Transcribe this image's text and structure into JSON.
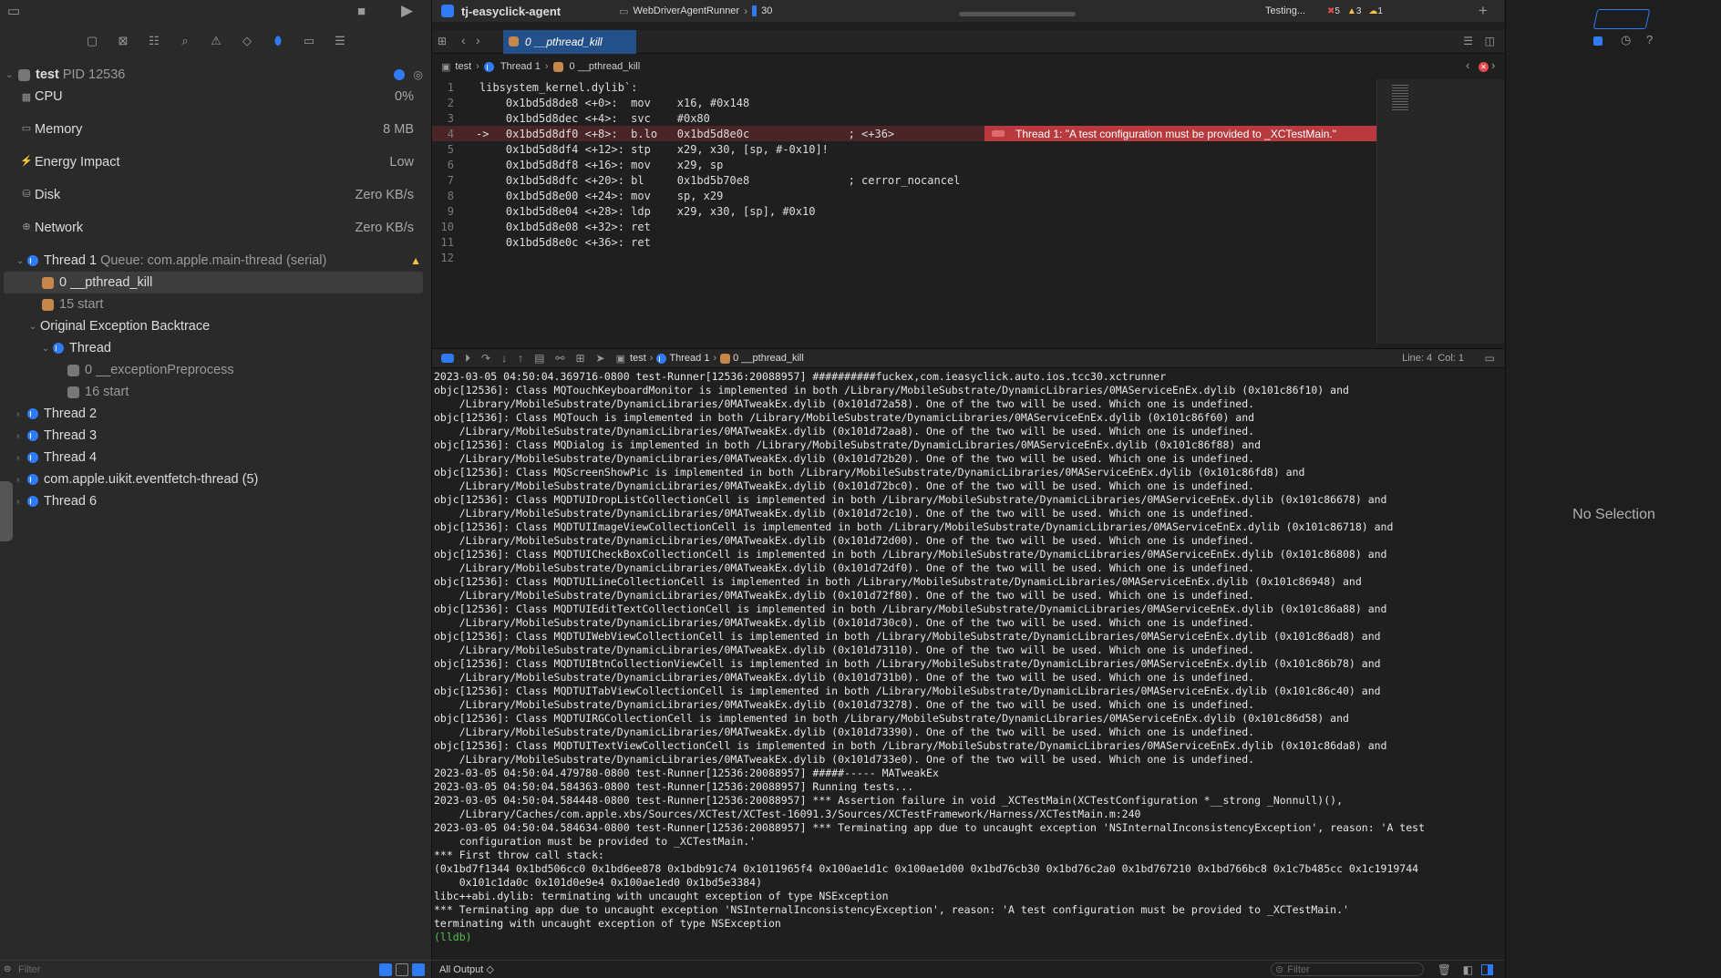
{
  "window": {
    "project": "tj-easyclick-agent",
    "scheme": "WebDriverAgentRunner",
    "device": "30",
    "status": "Testing...",
    "errors": "5",
    "warnings": "3",
    "issues": "1"
  },
  "debug_nav": {
    "process": "test",
    "pid": "PID 12536",
    "gauges": [
      {
        "label": "CPU",
        "value": "0%"
      },
      {
        "label": "Memory",
        "value": "8 MB"
      },
      {
        "label": "Energy Impact",
        "value": "Low"
      },
      {
        "label": "Disk",
        "value": "Zero KB/s"
      },
      {
        "label": "Network",
        "value": "Zero KB/s"
      }
    ],
    "thread1": "Thread 1",
    "thread1_queue": "Queue: com.apple.main-thread (serial)",
    "frame0": "0 __pthread_kill",
    "frame15": "15 start",
    "exc_bt": "Original Exception Backtrace",
    "exc_thread": "Thread",
    "exc_frame0": "0 __exceptionPreprocess",
    "exc_frame16": "16 start",
    "threads": [
      "Thread 2",
      "Thread 3",
      "Thread 4",
      "com.apple.uikit.eventfetch-thread (5)",
      "Thread 6"
    ],
    "filter_placeholder": "Filter"
  },
  "editor": {
    "tab": "0 __pthread_kill",
    "crumbs": [
      "test",
      "Thread 1",
      "0 __pthread_kill"
    ],
    "lines": [
      {
        "n": "1",
        "a": "",
        "t": "libsystem_kernel.dylib`:"
      },
      {
        "n": "2",
        "a": "",
        "t": "    0x1bd5d8de8 <+0>:  mov    x16, #0x148"
      },
      {
        "n": "3",
        "a": "",
        "t": "    0x1bd5d8dec <+4>:  svc    #0x80"
      },
      {
        "n": "4",
        "a": "->",
        "t": "    0x1bd5d8df0 <+8>:  b.lo   0x1bd5d8e0c               ; <+36>"
      },
      {
        "n": "5",
        "a": "",
        "t": "    0x1bd5d8df4 <+12>: stp    x29, x30, [sp, #-0x10]!"
      },
      {
        "n": "6",
        "a": "",
        "t": "    0x1bd5d8df8 <+16>: mov    x29, sp"
      },
      {
        "n": "7",
        "a": "",
        "t": "    0x1bd5d8dfc <+20>: bl     0x1bd5b70e8               ; cerror_nocancel"
      },
      {
        "n": "8",
        "a": "",
        "t": "    0x1bd5d8e00 <+24>: mov    sp, x29"
      },
      {
        "n": "9",
        "a": "",
        "t": "    0x1bd5d8e04 <+28>: ldp    x29, x30, [sp], #0x10"
      },
      {
        "n": "10",
        "a": "",
        "t": "    0x1bd5d8e08 <+32>: ret"
      },
      {
        "n": "11",
        "a": "",
        "t": "    0x1bd5d8e0c <+36>: ret"
      },
      {
        "n": "12",
        "a": "",
        "t": ""
      }
    ],
    "error_message": "Thread 1: \"A test configuration must be provided to _XCTestMain.\""
  },
  "debug_bar": {
    "crumbs": [
      "test",
      "Thread 1",
      "0 __pthread_kill"
    ],
    "position": "Line: 4  Col: 1"
  },
  "console": {
    "lines": [
      "2023-03-05 04:50:04.369716-0800 test-Runner[12536:20088957] ##########fuckex,com.ieasyclick.auto.ios.tcc30.xctrunner",
      "objc[12536]: Class MQTouchKeyboardMonitor is implemented in both /Library/MobileSubstrate/DynamicLibraries/0MAServiceEnEx.dylib (0x101c86f10) and",
      "    /Library/MobileSubstrate/DynamicLibraries/0MATweakEx.dylib (0x101d72a58). One of the two will be used. Which one is undefined.",
      "objc[12536]: Class MQTouch is implemented in both /Library/MobileSubstrate/DynamicLibraries/0MAServiceEnEx.dylib (0x101c86f60) and",
      "    /Library/MobileSubstrate/DynamicLibraries/0MATweakEx.dylib (0x101d72aa8). One of the two will be used. Which one is undefined.",
      "objc[12536]: Class MQDialog is implemented in both /Library/MobileSubstrate/DynamicLibraries/0MAServiceEnEx.dylib (0x101c86f88) and",
      "    /Library/MobileSubstrate/DynamicLibraries/0MATweakEx.dylib (0x101d72b20). One of the two will be used. Which one is undefined.",
      "objc[12536]: Class MQScreenShowPic is implemented in both /Library/MobileSubstrate/DynamicLibraries/0MAServiceEnEx.dylib (0x101c86fd8) and",
      "    /Library/MobileSubstrate/DynamicLibraries/0MATweakEx.dylib (0x101d72bc0). One of the two will be used. Which one is undefined.",
      "objc[12536]: Class MQDTUIDropListCollectionCell is implemented in both /Library/MobileSubstrate/DynamicLibraries/0MAServiceEnEx.dylib (0x101c86678) and",
      "    /Library/MobileSubstrate/DynamicLibraries/0MATweakEx.dylib (0x101d72c10). One of the two will be used. Which one is undefined.",
      "objc[12536]: Class MQDTUIImageViewCollectionCell is implemented in both /Library/MobileSubstrate/DynamicLibraries/0MAServiceEnEx.dylib (0x101c86718) and",
      "    /Library/MobileSubstrate/DynamicLibraries/0MATweakEx.dylib (0x101d72d00). One of the two will be used. Which one is undefined.",
      "objc[12536]: Class MQDTUICheckBoxCollectionCell is implemented in both /Library/MobileSubstrate/DynamicLibraries/0MAServiceEnEx.dylib (0x101c86808) and",
      "    /Library/MobileSubstrate/DynamicLibraries/0MATweakEx.dylib (0x101d72df0). One of the two will be used. Which one is undefined.",
      "objc[12536]: Class MQDTUILineCollectionCell is implemented in both /Library/MobileSubstrate/DynamicLibraries/0MAServiceEnEx.dylib (0x101c86948) and",
      "    /Library/MobileSubstrate/DynamicLibraries/0MATweakEx.dylib (0x101d72f80). One of the two will be used. Which one is undefined.",
      "objc[12536]: Class MQDTUIEditTextCollectionCell is implemented in both /Library/MobileSubstrate/DynamicLibraries/0MAServiceEnEx.dylib (0x101c86a88) and",
      "    /Library/MobileSubstrate/DynamicLibraries/0MATweakEx.dylib (0x101d730c0). One of the two will be used. Which one is undefined.",
      "objc[12536]: Class MQDTUIWebViewCollectionCell is implemented in both /Library/MobileSubstrate/DynamicLibraries/0MAServiceEnEx.dylib (0x101c86ad8) and",
      "    /Library/MobileSubstrate/DynamicLibraries/0MATweakEx.dylib (0x101d73110). One of the two will be used. Which one is undefined.",
      "objc[12536]: Class MQDTUIBtnCollectionViewCell is implemented in both /Library/MobileSubstrate/DynamicLibraries/0MAServiceEnEx.dylib (0x101c86b78) and",
      "    /Library/MobileSubstrate/DynamicLibraries/0MATweakEx.dylib (0x101d731b0). One of the two will be used. Which one is undefined.",
      "objc[12536]: Class MQDTUITabViewCollectionCell is implemented in both /Library/MobileSubstrate/DynamicLibraries/0MAServiceEnEx.dylib (0x101c86c40) and",
      "    /Library/MobileSubstrate/DynamicLibraries/0MATweakEx.dylib (0x101d73278). One of the two will be used. Which one is undefined.",
      "objc[12536]: Class MQDTUIRGCollectionCell is implemented in both /Library/MobileSubstrate/DynamicLibraries/0MAServiceEnEx.dylib (0x101c86d58) and",
      "    /Library/MobileSubstrate/DynamicLibraries/0MATweakEx.dylib (0x101d73390). One of the two will be used. Which one is undefined.",
      "objc[12536]: Class MQDTUITextViewCollectionCell is implemented in both /Library/MobileSubstrate/DynamicLibraries/0MAServiceEnEx.dylib (0x101c86da8) and",
      "    /Library/MobileSubstrate/DynamicLibraries/0MATweakEx.dylib (0x101d733e0). One of the two will be used. Which one is undefined.",
      "2023-03-05 04:50:04.479780-0800 test-Runner[12536:20088957] #####----- MATweakEx",
      "2023-03-05 04:50:04.584363-0800 test-Runner[12536:20088957] Running tests...",
      "2023-03-05 04:50:04.584448-0800 test-Runner[12536:20088957] *** Assertion failure in void _XCTestMain(XCTestConfiguration *__strong _Nonnull)(),",
      "    /Library/Caches/com.apple.xbs/Sources/XCTest/XCTest-16091.3/Sources/XCTestFramework/Harness/XCTestMain.m:240",
      "2023-03-05 04:50:04.584634-0800 test-Runner[12536:20088957] *** Terminating app due to uncaught exception 'NSInternalInconsistencyException', reason: 'A test",
      "    configuration must be provided to _XCTestMain.'",
      "*** First throw call stack:",
      "(0x1bd7f1344 0x1bd506cc0 0x1bd6ee878 0x1bdb91c74 0x1011965f4 0x100ae1d1c 0x100ae1d00 0x1bd76cb30 0x1bd76c2a0 0x1bd767210 0x1bd766bc8 0x1c7b485cc 0x1c1919744",
      "    0x101c1da0c 0x101d0e9e4 0x100ae1ed0 0x1bd5e3384)",
      "libc++abi.dylib: terminating with uncaught exception of type NSException",
      "*** Terminating app due to uncaught exception 'NSInternalInconsistencyException', reason: 'A test configuration must be provided to _XCTestMain.'",
      "terminating with uncaught exception of type NSException"
    ],
    "prompt": "(lldb)",
    "output_selector": "All Output ◇",
    "filter_placeholder": "Filter"
  },
  "inspector": {
    "empty": "No Selection"
  },
  "colors": {
    "accent": "#2f7bf6",
    "error": "#b83a3f",
    "warning": "#f5c542"
  }
}
